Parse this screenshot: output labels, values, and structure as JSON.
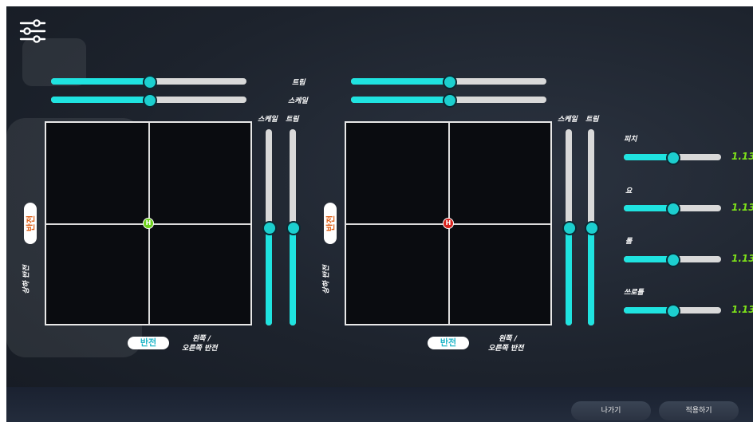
{
  "top_labels": {
    "trim": "트림",
    "scale": "스케일"
  },
  "vertical_labels": {
    "scale": "스케일",
    "trim": "트림"
  },
  "left_stick": {
    "trim_level": 0.5,
    "scale_level": 0.5,
    "v_scale_level": 0.5,
    "v_trim_level": 0.5,
    "marker_text": "H",
    "marker_color": "#6cd11a",
    "invert_button": "반전",
    "invert_side_button": "반전",
    "direction_invert_label": "상하 반전",
    "left_right_label_line1": "왼쪽 /",
    "left_right_label_line2": "오른쪽 반전"
  },
  "right_stick": {
    "trim_level": 0.5,
    "scale_level": 0.5,
    "v_scale_level": 0.5,
    "v_trim_level": 0.5,
    "marker_text": "H",
    "marker_color": "#d8221c",
    "invert_button": "반전",
    "invert_side_button": "반전",
    "direction_invert_label": "상하 반전",
    "left_right_label_line1": "왼쪽 /",
    "left_right_label_line2": "오른쪽 반전"
  },
  "axis_controls": [
    {
      "label": "피치",
      "value": "1.13",
      "level": 0.5
    },
    {
      "label": "요",
      "value": "1.13",
      "level": 0.5
    },
    {
      "label": "롤",
      "value": "1.13",
      "level": 0.5
    },
    {
      "label": "쓰로틀",
      "value": "1.13",
      "level": 0.5
    }
  ],
  "buttons": {
    "exit": "나가기",
    "apply": "적용하기"
  },
  "colors": {
    "accent": "#1fe3e0",
    "value": "#7ee21a",
    "invert_text": "#e0621a"
  }
}
